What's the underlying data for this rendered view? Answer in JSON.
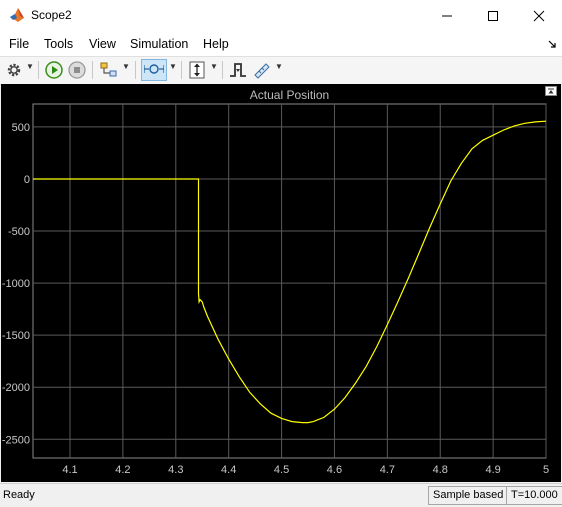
{
  "window": {
    "title": "Scope2",
    "icon": "matlab-icon"
  },
  "menu": {
    "items": [
      "File",
      "Tools",
      "View",
      "Simulation",
      "Help"
    ],
    "overflow_icon": "undock-arrow-icon"
  },
  "toolbar": {
    "buttons": [
      {
        "name": "settings",
        "icon": "gear-icon"
      },
      {
        "name": "run",
        "icon": "play-icon"
      },
      {
        "name": "stop",
        "icon": "stop-icon"
      },
      {
        "name": "highlight-simulink-block",
        "icon": "block-highlight-icon"
      },
      {
        "name": "zoom",
        "icon": "zoom-x-icon",
        "active": true
      },
      {
        "name": "scale-y-limits",
        "icon": "autoscale-icon"
      },
      {
        "name": "triggers",
        "icon": "trigger-icon"
      },
      {
        "name": "measurements",
        "icon": "ruler-icon"
      }
    ]
  },
  "scope": {
    "undock_icon": "axes-undock-icon",
    "colors": {
      "background": "#000000",
      "axes_bg": "#000000",
      "grid": "#5a5a5a",
      "tick_labels": "#c8c8c8",
      "title": "#bcbcbc",
      "trace": "#ffff00"
    }
  },
  "chart_data": {
    "type": "line",
    "title": "Actual Position",
    "xlabel": "",
    "ylabel": "",
    "xlim": [
      4.03,
      5.0
    ],
    "ylim": [
      -2680,
      720
    ],
    "x_ticks": [
      "4.1",
      "4.2",
      "4.3",
      "4.4",
      "4.5",
      "4.6",
      "4.7",
      "4.8",
      "4.9",
      "5"
    ],
    "y_ticks": [
      "500",
      "0",
      "-500",
      "-1000",
      "-1500",
      "-2000",
      "-2500"
    ],
    "x_tick_values": [
      4.1,
      4.2,
      4.3,
      4.4,
      4.5,
      4.6,
      4.7,
      4.8,
      4.9,
      5.0
    ],
    "y_tick_values": [
      500,
      0,
      -500,
      -1000,
      -1500,
      -2000,
      -2500
    ],
    "grid": true,
    "series": [
      {
        "color": "#ffff00",
        "x": [
          4.03,
          4.343,
          4.343,
          4.344,
          4.346,
          4.35,
          4.353,
          4.36,
          4.38,
          4.4,
          4.42,
          4.44,
          4.46,
          4.48,
          4.5,
          4.52,
          4.54,
          4.55,
          4.56,
          4.58,
          4.6,
          4.62,
          4.64,
          4.66,
          4.68,
          4.7,
          4.72,
          4.74,
          4.76,
          4.78,
          4.8,
          4.82,
          4.84,
          4.86,
          4.88,
          4.9,
          4.92,
          4.94,
          4.96,
          4.98,
          5.0
        ],
        "y": [
          0,
          0,
          -1100,
          -1180,
          -1160,
          -1180,
          -1230,
          -1320,
          -1540,
          -1730,
          -1900,
          -2050,
          -2160,
          -2250,
          -2300,
          -2330,
          -2340,
          -2340,
          -2330,
          -2290,
          -2210,
          -2100,
          -1960,
          -1800,
          -1610,
          -1400,
          -1180,
          -950,
          -710,
          -470,
          -240,
          -20,
          150,
          290,
          370,
          420,
          470,
          510,
          535,
          548,
          555
        ]
      }
    ]
  },
  "status": {
    "left": "Ready",
    "mode": "Sample based",
    "time": "T=10.000"
  }
}
